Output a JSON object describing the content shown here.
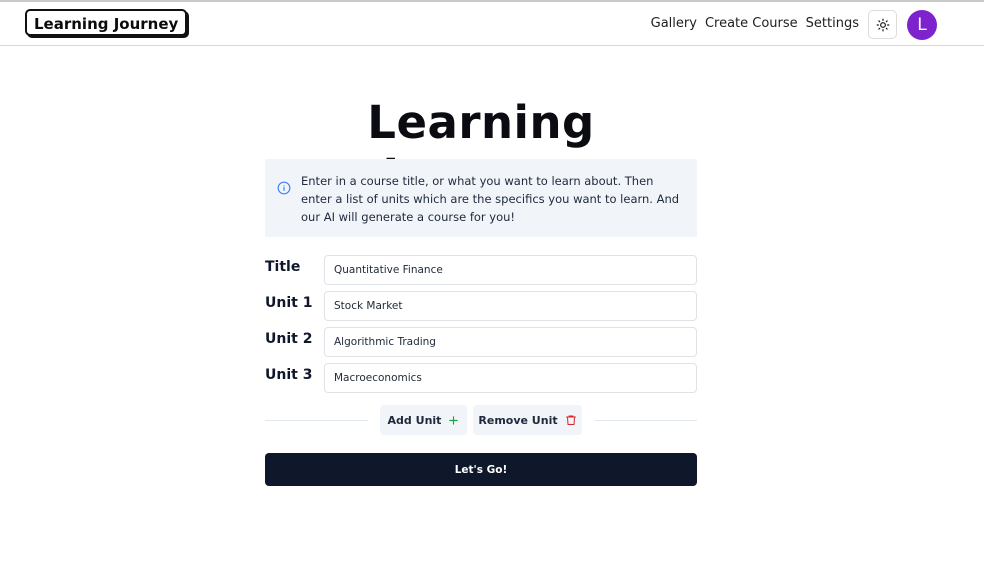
{
  "navbar": {
    "brand": "Learning Journey",
    "links": [
      "Gallery",
      "Create Course",
      "Settings"
    ],
    "avatar_initial": "L",
    "avatar_color": "#7e22ce"
  },
  "main": {
    "title": "Learning Journey",
    "info": "Enter in a course title, or what you want to learn about. Then enter a list of units which are the specifics you want to learn. And our AI will generate a course for you!"
  },
  "form": {
    "fields": [
      {
        "label": "Title",
        "value": "Quantitative Finance"
      },
      {
        "label": "Unit 1",
        "value": "Stock Market"
      },
      {
        "label": "Unit 2",
        "value": "Algorithmic Trading"
      },
      {
        "label": "Unit 3",
        "value": "Macroeconomics"
      }
    ],
    "add_unit": "Add Unit",
    "remove_unit": "Remove Unit",
    "submit": "Let's Go!"
  },
  "colors": {
    "primary": "#0f172a",
    "add_icon": "#16a34a",
    "remove_icon": "#dc2626",
    "info_icon": "#3b82f6"
  },
  "icons": [
    "sun-icon",
    "info-icon",
    "plus-icon",
    "trash-icon"
  ]
}
